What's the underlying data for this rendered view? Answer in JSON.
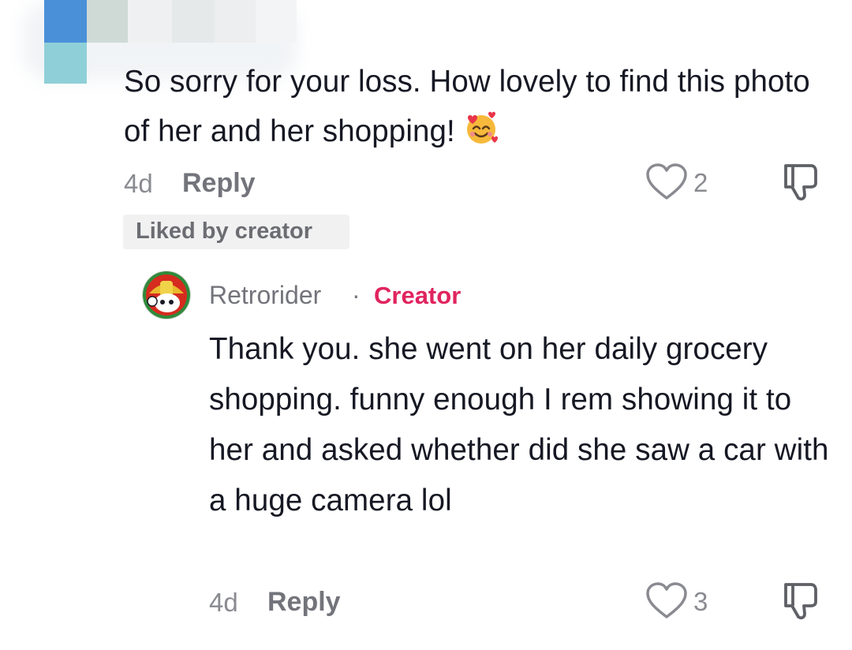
{
  "comment": {
    "text": "So sorry for your loss. How lovely to find this photo of her and her shopping!",
    "emoji_icon": "smiling-face-with-hearts-icon",
    "age": "4d",
    "reply_label": "Reply",
    "like_count": "2",
    "badge": "Liked by creator"
  },
  "reply": {
    "username": "Retrorider",
    "separator": "·",
    "role_badge": "Creator",
    "text": "Thank you. she went on her daily grocery shopping. funny enough I rem showing it to her and asked whether did she saw a car with a huge camera lol",
    "age": "4d",
    "reply_label": "Reply",
    "like_count": "3"
  },
  "colors": {
    "text": "#161823",
    "muted": "#8a8b91",
    "creator_accent": "#e0245e",
    "badge_bg": "#f1f1f2"
  }
}
